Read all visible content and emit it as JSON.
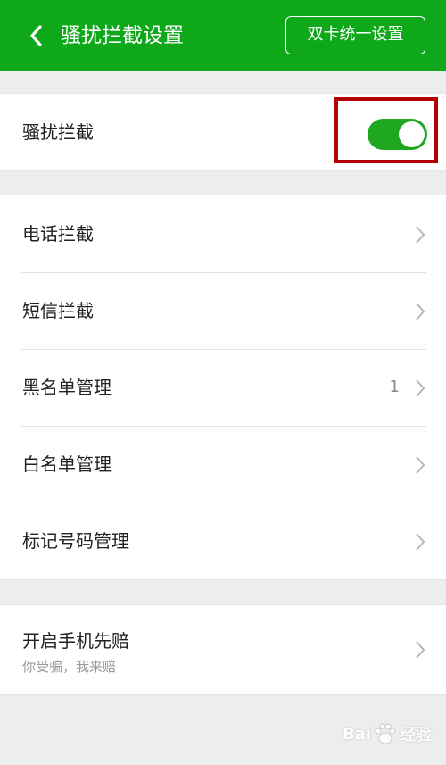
{
  "header": {
    "title": "骚扰拦截设置",
    "dual_card_button": "双卡统一设置",
    "background": "#0fa81b"
  },
  "toggle_section": {
    "label": "骚扰拦截",
    "toggle_on": true,
    "toggle_color": "#1fa71f",
    "highlight_color": "#b30000"
  },
  "menu": {
    "items": [
      {
        "label": "电话拦截",
        "count": ""
      },
      {
        "label": "短信拦截",
        "count": ""
      },
      {
        "label": "黑名单管理",
        "count": "1"
      },
      {
        "label": "白名单管理",
        "count": ""
      },
      {
        "label": "标记号码管理",
        "count": ""
      }
    ]
  },
  "compensation": {
    "title": "开启手机先赔",
    "subtitle": "你受骗，我来赔"
  },
  "watermark": {
    "brand_left": "Bai",
    "brand_right": "经验",
    "icon": "baidu-paw-icon"
  }
}
